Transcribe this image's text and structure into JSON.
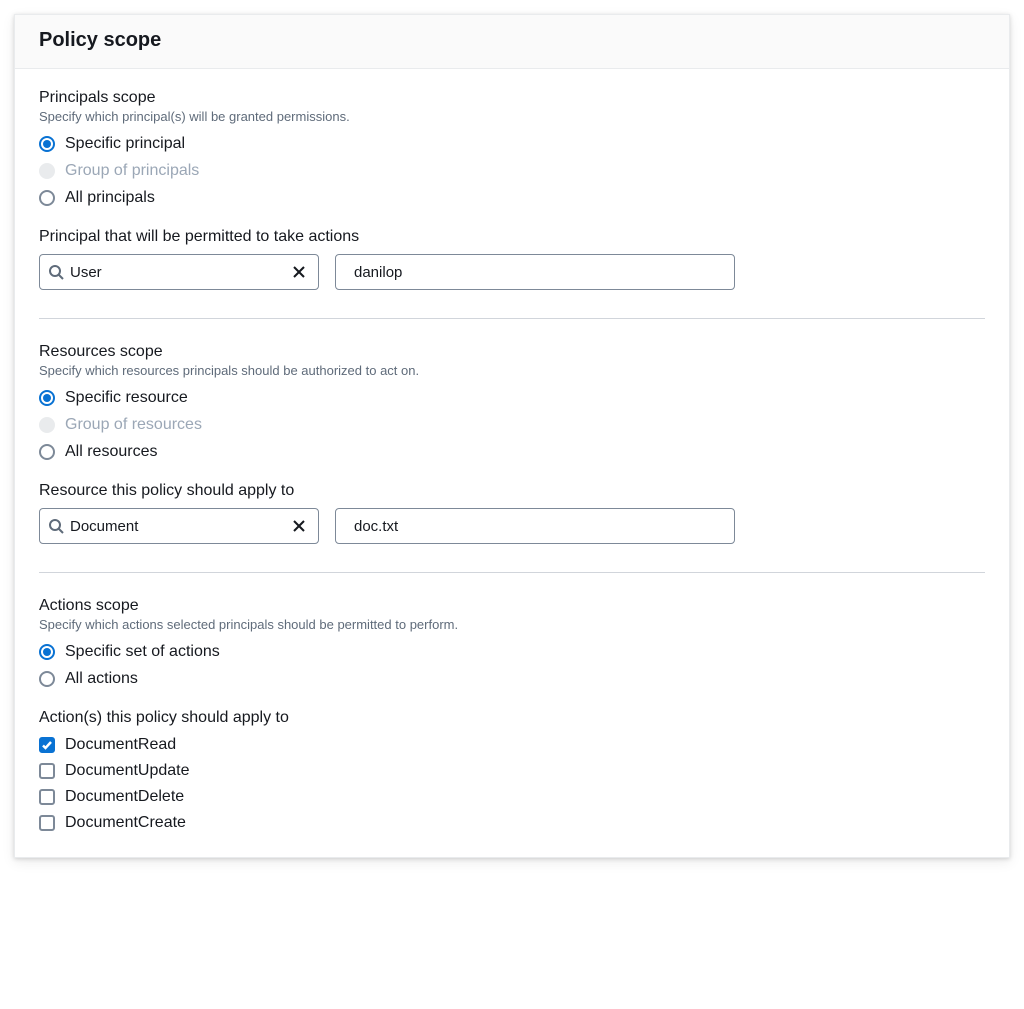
{
  "header": {
    "title": "Policy scope"
  },
  "principals": {
    "title": "Principals scope",
    "desc": "Specify which principal(s) will be granted permissions.",
    "options": {
      "specific": "Specific principal",
      "group": "Group of principals",
      "all": "All principals"
    },
    "selected": "specific",
    "field_label": "Principal that will be permitted to take actions",
    "type_value": "User",
    "name_value": "danilop"
  },
  "resources": {
    "title": "Resources scope",
    "desc": "Specify which resources principals should be authorized to act on.",
    "options": {
      "specific": "Specific resource",
      "group": "Group of resources",
      "all": "All resources"
    },
    "selected": "specific",
    "field_label": "Resource this policy should apply to",
    "type_value": "Document",
    "name_value": "doc.txt"
  },
  "actions": {
    "title": "Actions scope",
    "desc": "Specify which actions selected principals should be permitted to perform.",
    "options": {
      "specific": "Specific set of actions",
      "all": "All actions"
    },
    "selected": "specific",
    "field_label": "Action(s) this policy should apply to",
    "items": [
      {
        "label": "DocumentRead",
        "checked": true
      },
      {
        "label": "DocumentUpdate",
        "checked": false
      },
      {
        "label": "DocumentDelete",
        "checked": false
      },
      {
        "label": "DocumentCreate",
        "checked": false
      }
    ]
  },
  "colors": {
    "accent": "#0972d3",
    "text_muted": "#5f6b7a",
    "border": "#7d8998",
    "disabled": "#9ba7b6"
  }
}
